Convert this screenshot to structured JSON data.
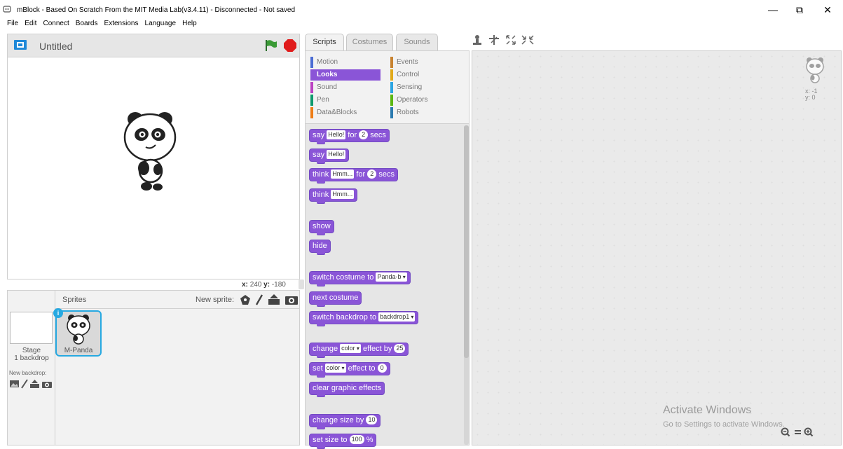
{
  "window": {
    "title": "mBlock - Based On Scratch From the MIT Media Lab(v3.4.11) - Disconnected - Not saved",
    "minimize": "—",
    "restore": "⧉",
    "close": "✕"
  },
  "menu": [
    "File",
    "Edit",
    "Connect",
    "Boards",
    "Extensions",
    "Language",
    "Help"
  ],
  "stage": {
    "project_title": "Untitled",
    "coords": {
      "x_label": "x:",
      "x": "240",
      "y_label": "y:",
      "y": "-180"
    }
  },
  "sprite_library": {
    "sprites_title": "Sprites",
    "new_sprite_label": "New sprite:",
    "stage_label_1": "Stage",
    "stage_label_2": "1 backdrop",
    "new_backdrop_label": "New backdrop:",
    "sprites": [
      {
        "name": "M-Panda"
      }
    ]
  },
  "tabs": [
    "Scripts",
    "Costumes",
    "Sounds"
  ],
  "categories": {
    "left": [
      {
        "label": "Motion",
        "color": "#4a6cd4"
      },
      {
        "label": "Looks",
        "color": "#8a55d7"
      },
      {
        "label": "Sound",
        "color": "#bb42c3"
      },
      {
        "label": "Pen",
        "color": "#0e9a6c"
      },
      {
        "label": "Data&Blocks",
        "color": "#ee7d16"
      }
    ],
    "right": [
      {
        "label": "Events",
        "color": "#c88330"
      },
      {
        "label": "Control",
        "color": "#e1a91a"
      },
      {
        "label": "Sensing",
        "color": "#2ca5e2"
      },
      {
        "label": "Operators",
        "color": "#5cb712"
      },
      {
        "label": "Robots",
        "color": "#2b7bb0"
      }
    ],
    "active": "Looks"
  },
  "blocks": {
    "say_for": {
      "t1": "say",
      "v1": "Hello!",
      "t2": "for",
      "v2": "2",
      "t3": "secs"
    },
    "say": {
      "t1": "say",
      "v1": "Hello!"
    },
    "think_for": {
      "t1": "think",
      "v1": "Hmm...",
      "t2": "for",
      "v2": "2",
      "t3": "secs"
    },
    "think": {
      "t1": "think",
      "v1": "Hmm..."
    },
    "show": "show",
    "hide": "hide",
    "switch_costume": {
      "t1": "switch costume to",
      "v1": "Panda-b"
    },
    "next_costume": "next costume",
    "switch_backdrop": {
      "t1": "switch backdrop to",
      "v1": "backdrop1"
    },
    "change_effect": {
      "t1": "change",
      "v1": "color",
      "t2": "effect by",
      "v2": "25"
    },
    "set_effect": {
      "t1": "set",
      "v1": "color",
      "t2": "effect to",
      "v2": "0"
    },
    "clear_effects": "clear graphic effects",
    "change_size": {
      "t1": "change size by",
      "v1": "10"
    },
    "set_size": {
      "t1": "set size to",
      "v1": "100",
      "t2": "%"
    }
  },
  "script_area": {
    "x_label": "x: -1",
    "y_label": "y: 0",
    "activate_title": "Activate Windows",
    "activate_sub": "Go to Settings to activate Windows."
  },
  "colors": {
    "looks": "#8a55d7",
    "accent": "#27a9e1",
    "flag": "#2e8b2e",
    "stop": "#e01b1b"
  }
}
